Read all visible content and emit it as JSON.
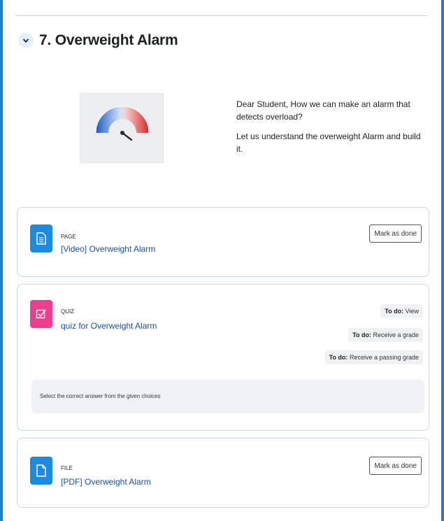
{
  "section": {
    "number_title": "7. Overweight Alarm",
    "summary_image_icon": "gauge-meter-image",
    "summary_paragraphs": [
      "Dear Student, How we can make an alarm that detects overload?",
      "Let us understand the overweight Alarm and build it."
    ]
  },
  "activities": [
    {
      "type": "PAGE",
      "name": "[Video] Overweight Alarm",
      "icon": "page-icon",
      "icon_color": "#1a8be0",
      "button_label": "Mark as done"
    },
    {
      "type": "QUIZ",
      "name": "quiz for Overweight Alarm",
      "icon": "quiz-icon",
      "icon_color": "#ef3e8e",
      "todos": [
        {
          "prefix": "To do:",
          "text": "View"
        },
        {
          "prefix": "To do:",
          "text": "Receive a grade"
        },
        {
          "prefix": "To do:",
          "text": "Receive a passing grade"
        }
      ],
      "description": "Select the correct answer from the given choices"
    },
    {
      "type": "FILE",
      "name": "[PDF] Overweight Alarm",
      "icon": "file-icon",
      "icon_color": "#1a8be0",
      "button_label": "Mark as done"
    }
  ]
}
